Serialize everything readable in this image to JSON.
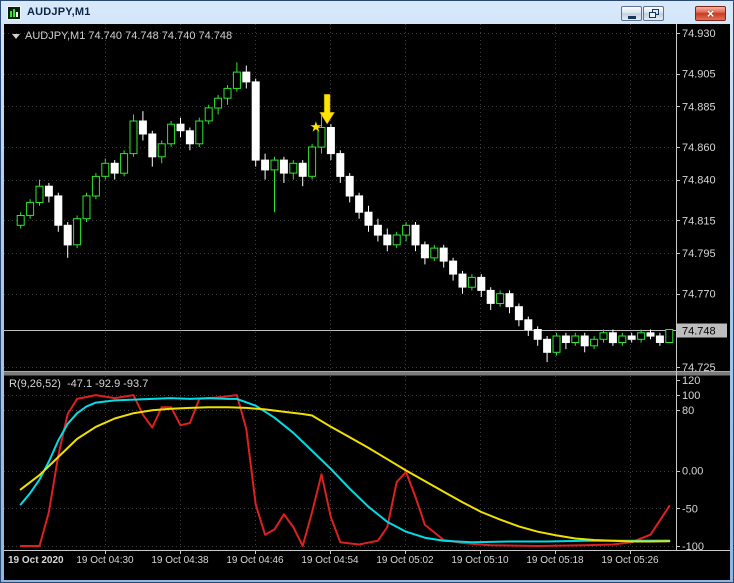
{
  "window": {
    "title": "AUDJPY,M1",
    "close_glyph": "×"
  },
  "chart": {
    "symbol_label": "AUDJPY,M1",
    "ohlc_values": "74.740 74.748 74.740 74.748"
  },
  "indicator": {
    "name": "R(9,26,52)",
    "values_text": "-47.1 -92.9 -93.7"
  },
  "colors": {
    "background": "#000000",
    "grid": "#3c3c3c",
    "axis_text": "#d6d6d6",
    "axis_line": "#c8c8c8",
    "up_candle": "#2ee62e",
    "down_candle": "#ffffff",
    "bid_line": "#bdbdbd",
    "line_fast": "#dd2020",
    "line_mid": "#00dde6",
    "line_slow": "#efe000",
    "annotation": "#ffe400",
    "splitter": "#7b7b7b"
  },
  "chart_data": {
    "type": "candlestick",
    "symbol": "AUDJPY",
    "timeframe": "M1",
    "title": "AUDJPY,M1",
    "price_range": [
      74.725,
      74.93
    ],
    "price_axis_labels": [
      "74.930",
      "74.905",
      "74.885",
      "74.860",
      "74.840",
      "74.815",
      "74.795",
      "74.770",
      "74.725"
    ],
    "current_price": 74.748,
    "current_price_label": "74.748",
    "time_labels": [
      "19 Oct 2020",
      "19 Oct 04:30",
      "19 Oct 04:38",
      "19 Oct 04:46",
      "19 Oct 04:54",
      "19 Oct 05:02",
      "19 Oct 05:10",
      "19 Oct 05:18",
      "19 Oct 05:26"
    ],
    "candles": [
      [
        74.812,
        74.82,
        74.81,
        74.818
      ],
      [
        74.818,
        74.828,
        74.816,
        74.826
      ],
      [
        74.826,
        74.84,
        74.824,
        74.836
      ],
      [
        74.836,
        74.838,
        74.826,
        74.83
      ],
      [
        74.83,
        74.832,
        74.808,
        74.812
      ],
      [
        74.812,
        74.814,
        74.792,
        74.8
      ],
      [
        74.8,
        74.818,
        74.798,
        74.816
      ],
      [
        74.816,
        74.832,
        74.814,
        74.83
      ],
      [
        74.83,
        74.844,
        74.828,
        74.842
      ],
      [
        74.842,
        74.853,
        74.84,
        74.85
      ],
      [
        74.85,
        74.852,
        74.84,
        74.844
      ],
      [
        74.844,
        74.858,
        74.842,
        74.856
      ],
      [
        74.856,
        74.88,
        74.854,
        74.876
      ],
      [
        74.876,
        74.882,
        74.864,
        74.868
      ],
      [
        74.868,
        74.87,
        74.848,
        74.854
      ],
      [
        74.854,
        74.864,
        74.85,
        74.862
      ],
      [
        74.862,
        74.876,
        74.86,
        74.874
      ],
      [
        74.874,
        74.878,
        74.866,
        74.87
      ],
      [
        74.87,
        74.872,
        74.858,
        74.862
      ],
      [
        74.862,
        74.878,
        74.86,
        74.876
      ],
      [
        74.876,
        74.886,
        74.874,
        74.884
      ],
      [
        74.884,
        74.892,
        74.88,
        74.89
      ],
      [
        74.89,
        74.898,
        74.886,
        74.896
      ],
      [
        74.896,
        74.912,
        74.894,
        74.906
      ],
      [
        74.906,
        74.91,
        74.896,
        74.9
      ],
      [
        74.9,
        74.902,
        74.848,
        74.852
      ],
      [
        74.852,
        74.856,
        74.84,
        74.846
      ],
      [
        74.846,
        74.854,
        74.82,
        74.852
      ],
      [
        74.852,
        74.854,
        74.838,
        74.844
      ],
      [
        74.844,
        74.852,
        74.84,
        74.85
      ],
      [
        74.85,
        74.852,
        74.836,
        74.842
      ],
      [
        74.842,
        74.862,
        74.84,
        74.86
      ],
      [
        74.86,
        74.88,
        74.856,
        74.872
      ],
      [
        74.872,
        74.874,
        74.852,
        74.856
      ],
      [
        74.856,
        74.858,
        74.838,
        74.842
      ],
      [
        74.842,
        74.844,
        74.826,
        74.83
      ],
      [
        74.83,
        74.832,
        74.816,
        74.82
      ],
      [
        74.82,
        74.824,
        74.808,
        74.812
      ],
      [
        74.812,
        74.816,
        74.802,
        74.806
      ],
      [
        74.806,
        74.81,
        74.796,
        74.8
      ],
      [
        74.8,
        74.808,
        74.798,
        74.806
      ],
      [
        74.806,
        74.814,
        74.802,
        74.812
      ],
      [
        74.812,
        74.814,
        74.796,
        74.8
      ],
      [
        74.8,
        74.802,
        74.788,
        74.792
      ],
      [
        74.792,
        74.8,
        74.79,
        74.798
      ],
      [
        74.798,
        74.8,
        74.786,
        74.79
      ],
      [
        74.79,
        74.792,
        74.778,
        74.782
      ],
      [
        74.782,
        74.784,
        74.77,
        74.774
      ],
      [
        74.774,
        74.782,
        74.772,
        74.78
      ],
      [
        74.78,
        74.782,
        74.768,
        74.772
      ],
      [
        74.772,
        74.774,
        74.76,
        74.764
      ],
      [
        74.764,
        74.772,
        74.762,
        74.77
      ],
      [
        74.77,
        74.772,
        74.758,
        74.762
      ],
      [
        74.762,
        74.764,
        74.75,
        74.754
      ],
      [
        74.754,
        74.756,
        74.744,
        74.748
      ],
      [
        74.748,
        74.75,
        74.738,
        74.742
      ],
      [
        74.742,
        74.744,
        74.728,
        74.734
      ],
      [
        74.734,
        74.746,
        74.732,
        74.744
      ],
      [
        74.744,
        74.746,
        74.736,
        74.74
      ],
      [
        74.74,
        74.746,
        74.738,
        74.744
      ],
      [
        74.744,
        74.746,
        74.734,
        74.738
      ],
      [
        74.738,
        74.744,
        74.736,
        74.742
      ],
      [
        74.742,
        74.748,
        74.74,
        74.746
      ],
      [
        74.746,
        74.748,
        74.738,
        74.74
      ],
      [
        74.74,
        74.746,
        74.738,
        74.744
      ],
      [
        74.744,
        74.746,
        74.74,
        74.742
      ],
      [
        74.742,
        74.748,
        74.74,
        74.746
      ],
      [
        74.746,
        74.748,
        74.742,
        74.744
      ],
      [
        74.744,
        74.746,
        74.738,
        74.74
      ],
      [
        74.74,
        74.748,
        74.74,
        74.748
      ]
    ],
    "oscillator": {
      "label": "R(9,26,52)",
      "current_values": [
        -47.1,
        -92.9,
        -93.7
      ],
      "range": [
        -100,
        120
      ],
      "axis_labels": [
        "120",
        "100",
        "80",
        "0.00",
        "-50",
        "-100"
      ],
      "axis_values": [
        120,
        100,
        80,
        0,
        -50,
        -100
      ],
      "series": [
        {
          "name": "r9",
          "color_key": "line_fast",
          "points": [
            [
              0,
              -100
            ],
            [
              2,
              -100
            ],
            [
              3,
              -55
            ],
            [
              4,
              20
            ],
            [
              5,
              75
            ],
            [
              6,
              95
            ],
            [
              8,
              100
            ],
            [
              10,
              96
            ],
            [
              12,
              100
            ],
            [
              13,
              74
            ],
            [
              14,
              57
            ],
            [
              15,
              84
            ],
            [
              16,
              84
            ],
            [
              17,
              60
            ],
            [
              18,
              63
            ],
            [
              19,
              95
            ],
            [
              21,
              97
            ],
            [
              23,
              100
            ],
            [
              24,
              55
            ],
            [
              25,
              -45
            ],
            [
              26,
              -85
            ],
            [
              27,
              -78
            ],
            [
              28,
              -58
            ],
            [
              29,
              -75
            ],
            [
              30,
              -100
            ],
            [
              31,
              -55
            ],
            [
              32,
              -5
            ],
            [
              33,
              -62
            ],
            [
              34,
              -95
            ],
            [
              36,
              -98
            ],
            [
              38,
              -93
            ],
            [
              39,
              -75
            ],
            [
              40,
              -15
            ],
            [
              41,
              -2
            ],
            [
              42,
              -35
            ],
            [
              43,
              -72
            ],
            [
              45,
              -92
            ],
            [
              47,
              -96
            ],
            [
              50,
              -99
            ],
            [
              55,
              -100
            ],
            [
              60,
              -99
            ],
            [
              63,
              -98
            ],
            [
              65,
              -95
            ],
            [
              67,
              -85
            ],
            [
              69,
              -47.1
            ]
          ]
        },
        {
          "name": "r26",
          "color_key": "line_mid",
          "points": [
            [
              0,
              -45
            ],
            [
              1,
              -30
            ],
            [
              2,
              -12
            ],
            [
              3,
              12
            ],
            [
              4,
              40
            ],
            [
              5,
              62
            ],
            [
              6,
              76
            ],
            [
              7,
              85
            ],
            [
              8,
              90
            ],
            [
              10,
              93
            ],
            [
              12,
              94
            ],
            [
              14,
              95
            ],
            [
              16,
              96
            ],
            [
              18,
              95
            ],
            [
              20,
              96
            ],
            [
              22,
              95
            ],
            [
              23,
              95
            ],
            [
              25,
              86
            ],
            [
              27,
              70
            ],
            [
              29,
              50
            ],
            [
              31,
              26
            ],
            [
              33,
              2
            ],
            [
              35,
              -24
            ],
            [
              37,
              -48
            ],
            [
              39,
              -68
            ],
            [
              41,
              -81
            ],
            [
              43,
              -89
            ],
            [
              45,
              -93
            ],
            [
              48,
              -95
            ],
            [
              52,
              -94
            ],
            [
              56,
              -94
            ],
            [
              60,
              -93
            ],
            [
              65,
              -93
            ],
            [
              69,
              -92.9
            ]
          ]
        },
        {
          "name": "r52",
          "color_key": "line_slow",
          "points": [
            [
              0,
              -25
            ],
            [
              2,
              -6
            ],
            [
              4,
              18
            ],
            [
              6,
              42
            ],
            [
              8,
              58
            ],
            [
              10,
              69
            ],
            [
              12,
              76
            ],
            [
              14,
              80
            ],
            [
              16,
              82
            ],
            [
              18,
              83
            ],
            [
              20,
              84
            ],
            [
              22,
              84
            ],
            [
              24,
              83
            ],
            [
              26,
              81
            ],
            [
              28,
              78
            ],
            [
              30,
              75
            ],
            [
              31,
              73
            ],
            [
              33,
              58
            ],
            [
              35,
              44
            ],
            [
              37,
              30
            ],
            [
              39,
              15
            ],
            [
              41,
              0
            ],
            [
              43,
              -14
            ],
            [
              45,
              -28
            ],
            [
              47,
              -42
            ],
            [
              49,
              -55
            ],
            [
              51,
              -65
            ],
            [
              53,
              -74
            ],
            [
              55,
              -81
            ],
            [
              57,
              -86
            ],
            [
              59,
              -90
            ],
            [
              61,
              -92
            ],
            [
              63,
              -93
            ],
            [
              65,
              -94
            ],
            [
              67,
              -94
            ],
            [
              69,
              -93.7
            ]
          ]
        }
      ]
    },
    "annotations": [
      {
        "type": "star",
        "x_index": 31.4,
        "price": 74.8725
      },
      {
        "type": "arrow-down",
        "x_index": 32.6,
        "price": 74.874
      }
    ]
  }
}
